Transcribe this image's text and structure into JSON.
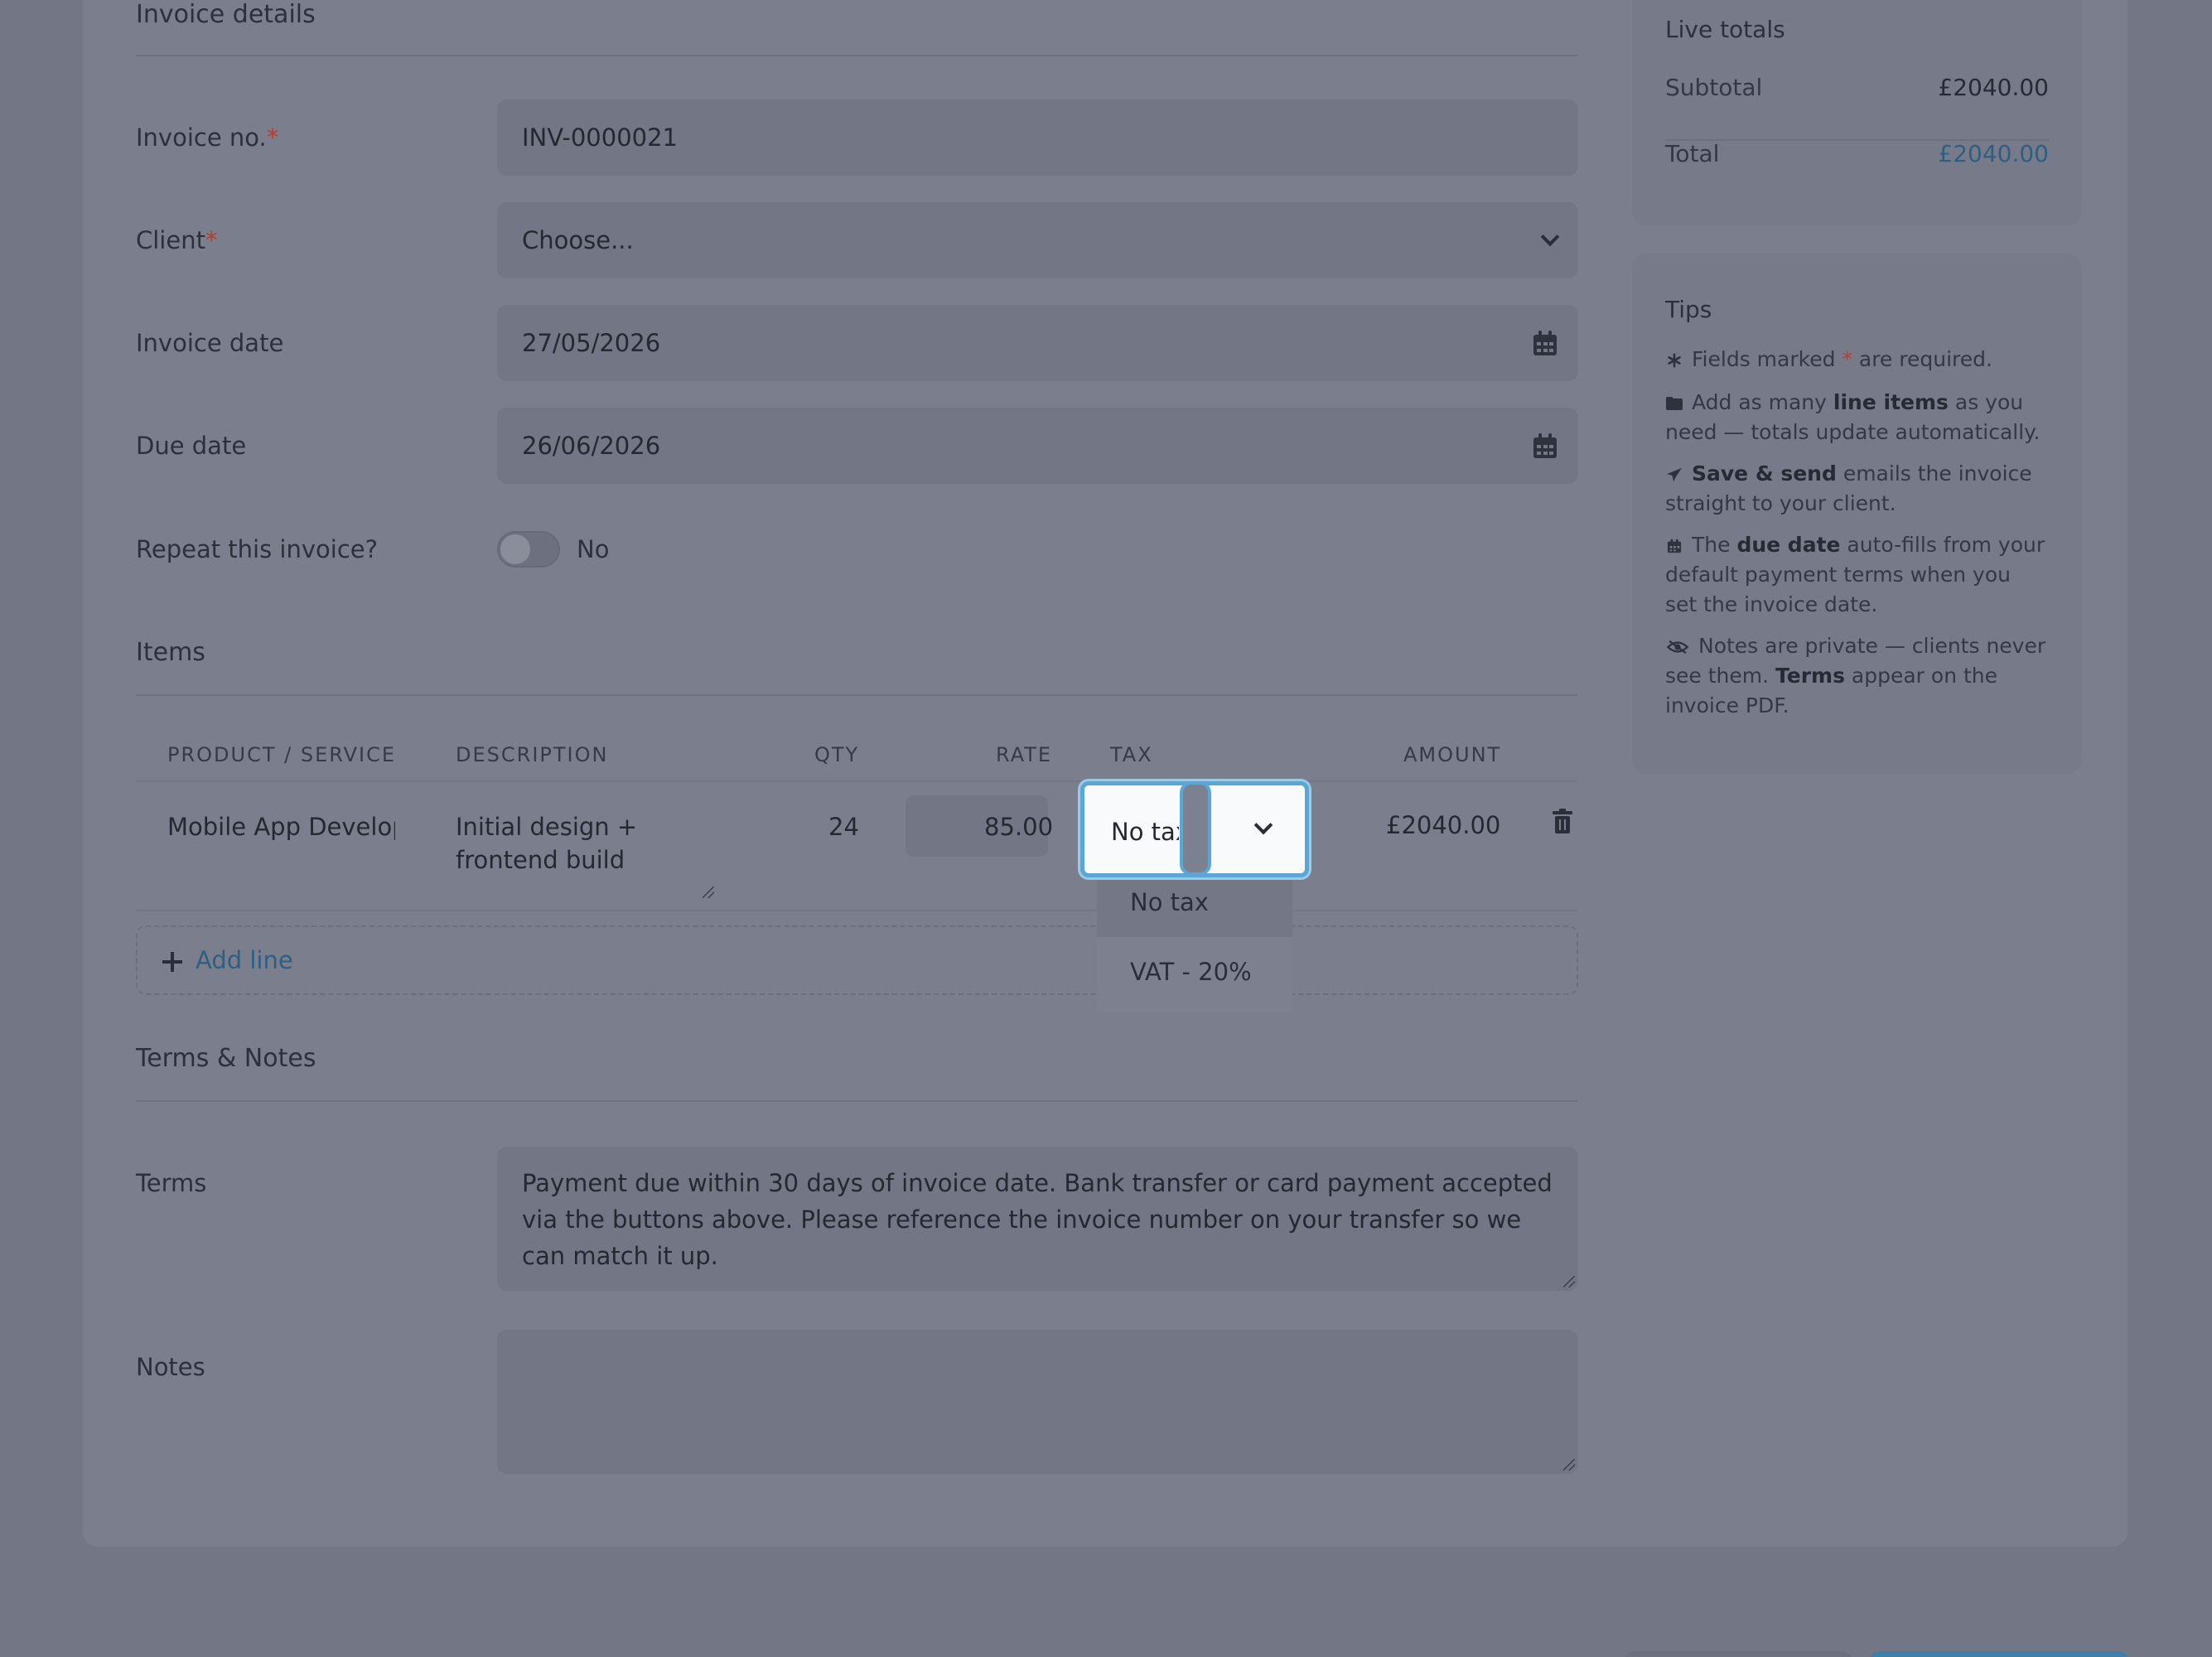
{
  "details": {
    "title": "Invoice details",
    "invoice_no_label": "Invoice no.",
    "invoice_no_value": "INV-0000021",
    "client_label": "Client",
    "client_value": "Choose...",
    "invoice_date_label": "Invoice date",
    "invoice_date_value": "27/05/2026",
    "due_date_label": "Due date",
    "due_date_value": "26/06/2026",
    "repeat_label": "Repeat this invoice?",
    "repeat_value": "No",
    "required_mark": "*"
  },
  "items": {
    "title": "Items",
    "headers": [
      "PRODUCT / SERVICE",
      "DESCRIPTION",
      "QTY",
      "RATE",
      "TAX",
      "AMOUNT"
    ],
    "row": {
      "product": "Mobile App Develop",
      "description_line1": "Initial design +",
      "description_line2": "frontend build",
      "qty": "24",
      "rate": "85.00",
      "tax": "No tax",
      "amount": "£2040.00"
    },
    "add_line": "Add line",
    "tax_options": [
      "No tax",
      "VAT - 20%"
    ],
    "tax_selected": "No tax"
  },
  "terms_notes": {
    "title": "Terms & Notes",
    "terms_label": "Terms",
    "terms_value": "Payment due within 30 days of invoice date. Bank transfer or card payment accepted via the buttons above. Please reference the invoice number on your transfer so we can match it up.",
    "notes_label": "Notes",
    "notes_value": ""
  },
  "totals": {
    "title": "Live totals",
    "subtotal_label": "Subtotal",
    "subtotal_value": "£2040.00",
    "total_label": "Total",
    "total_value": "£2040.00"
  },
  "tips": {
    "title": "Tips",
    "t1_a": "Fields marked ",
    "t1_star": "*",
    "t1_b": " are required.",
    "t2_a": "Add as many ",
    "t2_b": "line items",
    "t2_c": " as you need — totals update automatically.",
    "t3_a": "Save & send",
    "t3_b": " emails the invoice straight to your client.",
    "t4_a": "The ",
    "t4_b": "due date",
    "t4_c": " auto-fills from your default payment terms when you set the invoice date.",
    "t5_a": "Notes are private — clients never see them. ",
    "t5_b": "Terms",
    "t5_c": " appear on the invoice PDF."
  },
  "colors": {
    "backdrop": "#727685",
    "accent": "#5aa7d6",
    "link": "#2e5f82",
    "required": "#c0392b"
  },
  "icons": [
    "chevron-down-icon",
    "calendar-icon",
    "trash-icon",
    "plus-icon",
    "asterisk-icon",
    "folder-icon",
    "paper-plane-icon",
    "eye-slash-icon"
  ]
}
